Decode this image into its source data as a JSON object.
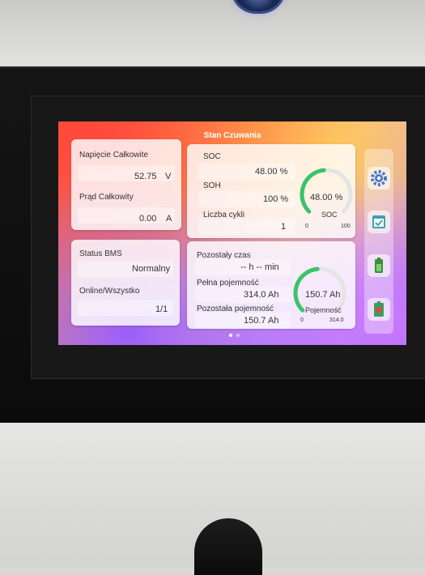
{
  "header": {
    "title": "Stan Czuwania"
  },
  "card_voltage": {
    "voltage_label": "Napięcie Całkowite",
    "voltage_value": "52.75",
    "voltage_unit": "V",
    "current_label": "Prąd Całkowity",
    "current_value": "0.00",
    "current_unit": "A"
  },
  "card_soc": {
    "soc_label": "SOC",
    "soc_value": "48.00 %",
    "soh_label": "SOH",
    "soh_value": "100 %",
    "cycles_label": "Liczba cykli",
    "cycles_value": "1",
    "gauge": {
      "value_text": "48.00 %",
      "caption": "SOC",
      "min": "0",
      "max": "100",
      "fraction": 0.48
    }
  },
  "card_status": {
    "status_label": "Status BMS",
    "status_value": "Normalny",
    "online_label": "Online/Wszystko",
    "online_value": "1/1"
  },
  "card_capacity": {
    "time_label": "Pozostały czas",
    "time_value": "-- h -- min",
    "full_label": "Pełna pojemność",
    "full_value": "314.0 Ah",
    "remaining_label": "Pozostała pojemność",
    "remaining_value": "150.7 Ah",
    "gauge": {
      "value_text": "150.7 Ah",
      "caption": "Pojemność",
      "min": "0",
      "max": "314.0",
      "fraction": 0.48
    }
  },
  "sidebar": {
    "icons": [
      "gear-icon",
      "checklist-icon",
      "battery-icon",
      "battery-heart-icon"
    ]
  },
  "pager": {
    "pages": 2,
    "active": 0
  },
  "colors": {
    "gauge_green": "#3cc36a",
    "gauge_track": "#e4e4e4"
  }
}
